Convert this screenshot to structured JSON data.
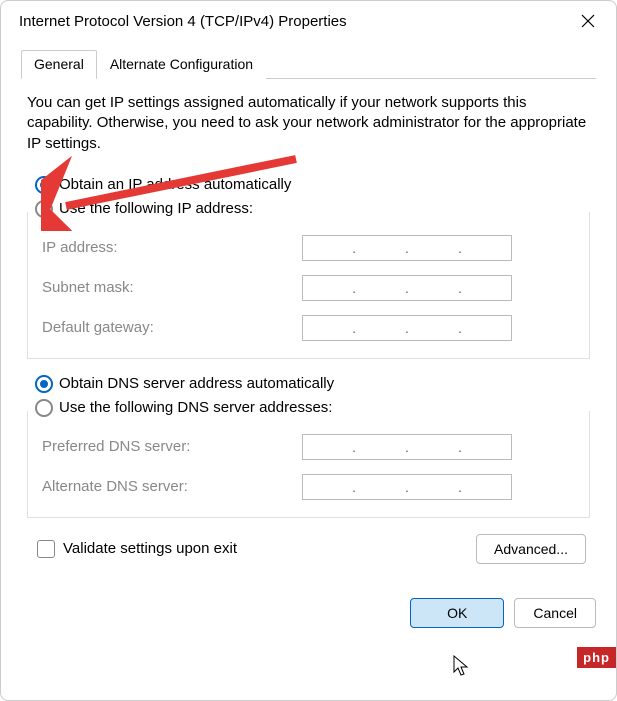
{
  "window": {
    "title": "Internet Protocol Version 4 (TCP/IPv4) Properties"
  },
  "tabs": {
    "general": "General",
    "alternate": "Alternate Configuration"
  },
  "description": "You can get IP settings assigned automatically if your network supports this capability. Otherwise, you need to ask your network administrator for the appropriate IP settings.",
  "ip": {
    "auto": "Obtain an IP address automatically",
    "manual": "Use the following IP address:",
    "address_label": "IP address:",
    "subnet_label": "Subnet mask:",
    "gateway_label": "Default gateway:"
  },
  "dns": {
    "auto": "Obtain DNS server address automatically",
    "manual": "Use the following DNS server addresses:",
    "preferred_label": "Preferred DNS server:",
    "alternate_label": "Alternate DNS server:"
  },
  "validate_label": "Validate settings upon exit",
  "advanced_label": "Advanced...",
  "ok_label": "OK",
  "cancel_label": "Cancel",
  "badge": "php"
}
